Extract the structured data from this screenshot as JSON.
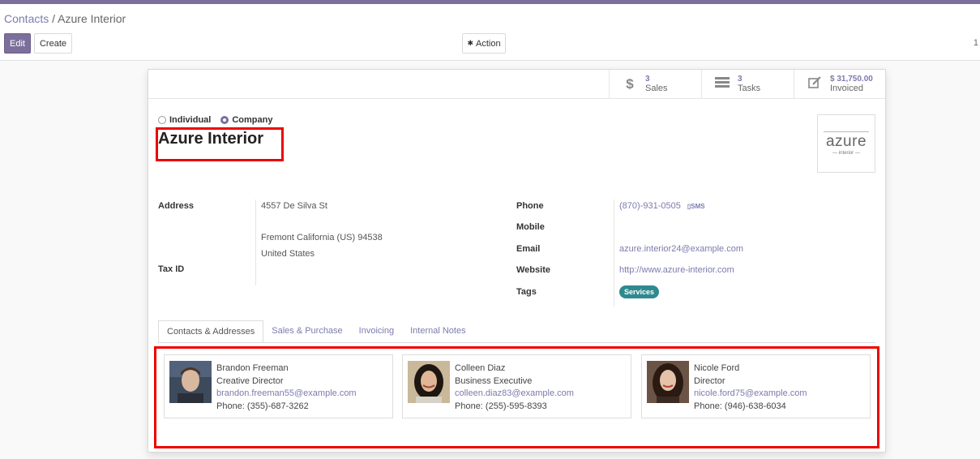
{
  "breadcrumb": {
    "parent": "Contacts",
    "separator": " / ",
    "current": "Azure Interior"
  },
  "buttons": {
    "edit": "Edit",
    "create": "Create",
    "action": "Action"
  },
  "pager": "1",
  "stats": [
    {
      "num": "3",
      "label": "Sales",
      "icon": "dollar-icon"
    },
    {
      "num": "3",
      "label": "Tasks",
      "icon": "tasks-icon"
    },
    {
      "num": "$ 31,750.00",
      "label": "Invoiced",
      "icon": "invoice-edit-icon"
    }
  ],
  "company_type": {
    "individual": "Individual",
    "company": "Company",
    "selected": "company"
  },
  "name": "Azure Interior",
  "logo": {
    "word": "azure",
    "sub": "— interior —"
  },
  "fields": {
    "address_label": "Address",
    "street": "4557 De Silva St",
    "city_line": "Fremont  California (US)  94538",
    "country": "United States",
    "taxid_label": "Tax ID",
    "phone_label": "Phone",
    "phone": "(870)-931-0505",
    "sms": "SMS",
    "mobile_label": "Mobile",
    "email_label": "Email",
    "email": "azure.interior24@example.com",
    "website_label": "Website",
    "website": "http://www.azure-interior.com",
    "tags_label": "Tags",
    "tag": "Services"
  },
  "tabs": [
    "Contacts & Addresses",
    "Sales & Purchase",
    "Invoicing",
    "Internal Notes"
  ],
  "contacts": [
    {
      "name": "Brandon Freeman",
      "role": "Creative Director",
      "email": "brandon.freeman55@example.com",
      "phone": "Phone: (355)-687-3262"
    },
    {
      "name": "Colleen Diaz",
      "role": "Business Executive",
      "email": "colleen.diaz83@example.com",
      "phone": "Phone: (255)-595-8393"
    },
    {
      "name": "Nicole Ford",
      "role": "Director",
      "email": "nicole.ford75@example.com",
      "phone": "Phone: (946)-638-6034"
    }
  ],
  "colors": {
    "brand": "#7c6f9b",
    "link": "#7c7bad",
    "tag": "#2e8a8f",
    "highlight": "#ee0000"
  }
}
